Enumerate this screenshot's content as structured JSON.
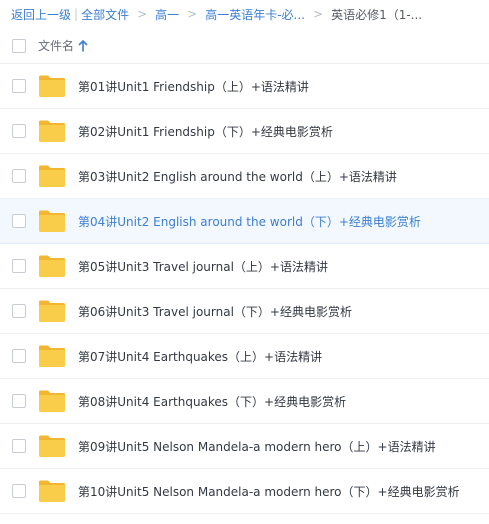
{
  "breadcrumb": {
    "back": "返回上一级",
    "all_files": "全部文件",
    "level1": "高一",
    "level2": "高一英语年卡-必...",
    "current": "英语必修1（1-...",
    "separator": ">",
    "divider": "|"
  },
  "header": {
    "filename_label": "文件名",
    "sort_icon": "arrow-up-icon"
  },
  "rows": [
    {
      "name": "第01讲Unit1 Friendship（上）+语法精讲",
      "icon": "folder-icon"
    },
    {
      "name": "第02讲Unit1 Friendship（下）+经典电影赏析",
      "icon": "folder-icon"
    },
    {
      "name": "第03讲Unit2 English around the world（上）+语法精讲",
      "icon": "folder-icon"
    },
    {
      "name": "第04讲Unit2 English around the world（下）+经典电影赏析",
      "icon": "folder-icon",
      "highlighted": true
    },
    {
      "name": "第05讲Unit3 Travel journal（上）+语法精讲",
      "icon": "folder-icon"
    },
    {
      "name": "第06讲Unit3 Travel journal（下）+经典电影赏析",
      "icon": "folder-icon"
    },
    {
      "name": "第07讲Unit4 Earthquakes（上）+语法精讲",
      "icon": "folder-icon"
    },
    {
      "name": "第08讲Unit4 Earthquakes（下）+经典电影赏析",
      "icon": "folder-icon"
    },
    {
      "name": "第09讲Unit5 Nelson Mandela-a modern hero（上）+语法精讲",
      "icon": "folder-icon"
    },
    {
      "name": "第10讲Unit5 Nelson Mandela-a modern hero（下）+经典电影赏析",
      "icon": "folder-icon"
    }
  ],
  "colors": {
    "link": "#3b7fd1",
    "folder": "#f9cd49",
    "folder_dark": "#f2b630",
    "highlight_bg": "#f3f8fe"
  }
}
